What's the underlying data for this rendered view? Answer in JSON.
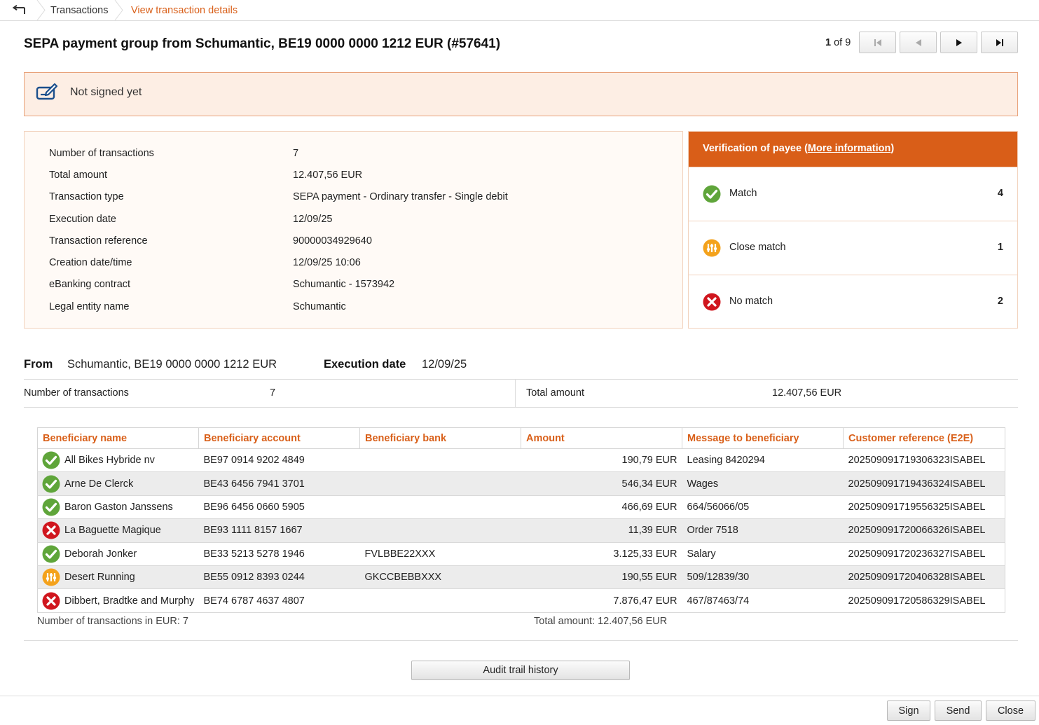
{
  "breadcrumb": {
    "items": [
      "Transactions",
      "View transaction details"
    ]
  },
  "header": {
    "title": "SEPA payment group from Schumantic, BE19 0000 0000 1212 EUR (#57641)",
    "pager_current": "1",
    "pager_of": "of 9"
  },
  "status_banner": {
    "text": "Not signed yet",
    "icon": "signature-pen-icon"
  },
  "details": {
    "rows": [
      {
        "label": "Number of transactions",
        "value": "7"
      },
      {
        "label": "Total amount",
        "value": "12.407,56 EUR"
      },
      {
        "label": "Transaction type",
        "value": "SEPA payment - Ordinary transfer - Single debit"
      },
      {
        "label": "Execution date",
        "value": "12/09/25"
      },
      {
        "label": "Transaction reference",
        "value": "90000034929640"
      },
      {
        "label": "Creation date/time",
        "value": "12/09/25 10:06"
      },
      {
        "label": "eBanking contract",
        "value": "Schumantic - 1573942"
      },
      {
        "label": "Legal entity name",
        "value": "Schumantic"
      }
    ]
  },
  "verification": {
    "title": "Verification of payee",
    "link_open": "(",
    "link": "More information",
    "link_close": ")",
    "rows": [
      {
        "label": "Match",
        "count": "4",
        "icon": "match-check-icon"
      },
      {
        "label": "Close match",
        "count": "1",
        "icon": "close-match-icon"
      },
      {
        "label": "No match",
        "count": "2",
        "icon": "no-match-icon"
      }
    ]
  },
  "summary": {
    "from_label": "From",
    "from_value": "Schumantic, BE19 0000 0000 1212 EUR",
    "exec_label": "Execution date",
    "exec_value": "12/09/25",
    "count_label": "Number of transactions",
    "count_value": "7",
    "total_label": "Total amount",
    "total_value": "12.407,56 EUR"
  },
  "table": {
    "columns": [
      "Beneficiary name",
      "Beneficiary account",
      "Beneficiary bank",
      "Amount",
      "Message to beneficiary",
      "Customer reference (E2E)"
    ],
    "rows": [
      {
        "status": "match",
        "name": "All Bikes Hybride nv",
        "account": "BE97 0914 9202 4849",
        "bank": "",
        "amount": "190,79 EUR",
        "message": "Leasing 8420294",
        "ref": "20250909171930632 3ISABEL"
      },
      {
        "status": "match",
        "name": "Arne De Clerck",
        "account": "BE43 6456 7941 3701",
        "bank": "",
        "amount": "546,34 EUR",
        "message": "Wages",
        "ref": "20250909171943632 4ISABEL"
      },
      {
        "status": "match",
        "name": "Baron Gaston Janssens",
        "account": "BE96 6456 0660 5905",
        "bank": "",
        "amount": "466,69 EUR",
        "message": "664/56066/05",
        "ref": "20250909171955632 5ISABEL"
      },
      {
        "status": "nomatch",
        "name": "La Baguette Magique",
        "account": "BE93 1111 8157 1667",
        "bank": "",
        "amount": "11,39 EUR",
        "message": "Order 7518",
        "ref": "20250909172006632 6ISABEL"
      },
      {
        "status": "match",
        "name": "Deborah Jonker",
        "account": "BE33 5213 5278 1946",
        "bank": "FVLBBE22XXX",
        "amount": "3.125,33 EUR",
        "message": "Salary",
        "ref": "20250909172023632 7ISABEL"
      },
      {
        "status": "close",
        "name": "Desert Running",
        "account": "BE55 0912 8393 0244",
        "bank": "GKCCBEBBXXX",
        "amount": "190,55 EUR",
        "message": "509/12839/30",
        "ref": "20250909172040632 8ISABEL"
      },
      {
        "status": "nomatch",
        "name": "Dibbert, Bradtke and Murphy",
        "account": "BE74 6787 4637 4807",
        "bank": "",
        "amount": "7.876,47 EUR",
        "message": "467/87463/74",
        "ref": "20250909172058632 9ISABEL"
      }
    ],
    "footer_count": "Number of transactions in EUR: 7",
    "footer_total": "Total amount: 12.407,56 EUR"
  },
  "buttons": {
    "audit": "Audit trail history",
    "sign": "Sign",
    "send": "Send",
    "close": "Close"
  },
  "colors": {
    "accent": "#d95e18",
    "banner_bg": "#fdeee4",
    "match": "#5fa53a",
    "close_match": "#f4a21c",
    "no_match": "#d0161e"
  }
}
